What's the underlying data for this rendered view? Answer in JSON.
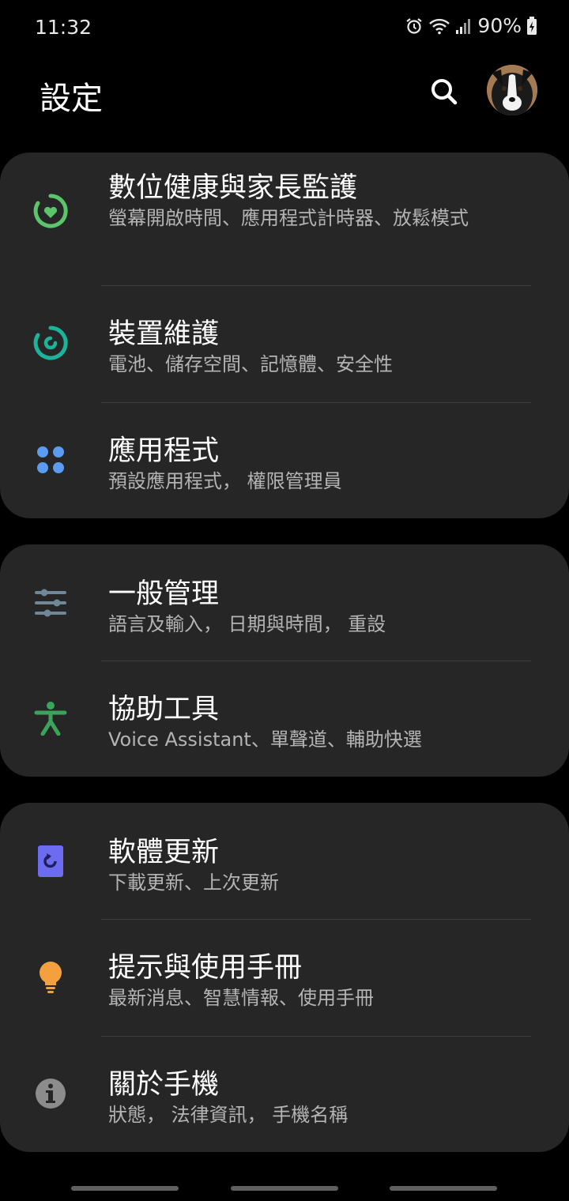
{
  "status": {
    "time": "11:32",
    "battery": "90%",
    "icons": [
      "alarm-icon",
      "wifi-icon",
      "signal-icon",
      "battery-charging-icon"
    ]
  },
  "header": {
    "title": "設定",
    "search_icon": "search-icon",
    "avatar": "profile-avatar"
  },
  "groups": [
    {
      "items": [
        {
          "icon": "digital-wellbeing-icon",
          "color": "#5cc46b",
          "title": "數位健康與家長監護",
          "subtitle": "螢幕開啟時間、應用程式計時器、放鬆模式"
        },
        {
          "icon": "device-care-icon",
          "color": "#1bb39a",
          "title": "裝置維護",
          "subtitle": "電池、儲存空間、記憶體、安全性"
        },
        {
          "icon": "apps-icon",
          "color": "#5b9cf2",
          "title": "應用程式",
          "subtitle": "預設應用程式， 權限管理員"
        }
      ]
    },
    {
      "items": [
        {
          "icon": "general-management-icon",
          "color": "#6f8797",
          "title": "一般管理",
          "subtitle": "語言及輸入， 日期與時間， 重設"
        },
        {
          "icon": "accessibility-icon",
          "color": "#3aa55a",
          "title": "協助工具",
          "subtitle": "Voice Assistant、單聲道、輔助快選"
        }
      ]
    },
    {
      "items": [
        {
          "icon": "software-update-icon",
          "color": "#6b6cf0",
          "title": "軟體更新",
          "subtitle": "下載更新、上次更新"
        },
        {
          "icon": "tips-lightbulb-icon",
          "color": "#f4a03c",
          "title": "提示與使用手冊",
          "subtitle": "最新消息、智慧情報、使用手冊"
        },
        {
          "icon": "about-phone-icon",
          "color": "#8c8c8c",
          "title": "關於手機",
          "subtitle": "狀態， 法律資訊， 手機名稱"
        }
      ]
    }
  ]
}
